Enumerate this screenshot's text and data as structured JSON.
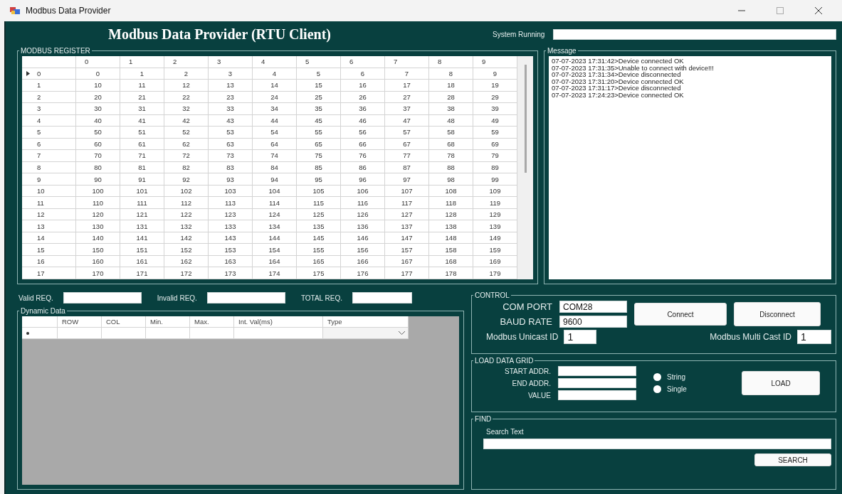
{
  "window": {
    "title": "Modbus Data Provider"
  },
  "header": {
    "title": "Modbus Data Provider (RTU Client)",
    "status_label": "System Running"
  },
  "register": {
    "title": "MODBUS REGISTER",
    "columns": [
      "0",
      "1",
      "2",
      "3",
      "4",
      "5",
      "6",
      "7",
      "8",
      "9"
    ],
    "rows": [
      {
        "header": "0",
        "selected": true,
        "cells": [
          "0",
          "1",
          "2",
          "3",
          "4",
          "5",
          "6",
          "7",
          "8",
          "9"
        ]
      },
      {
        "header": "1",
        "selected": false,
        "cells": [
          "10",
          "11",
          "12",
          "13",
          "14",
          "15",
          "16",
          "17",
          "18",
          "19"
        ]
      },
      {
        "header": "2",
        "selected": false,
        "cells": [
          "20",
          "21",
          "22",
          "23",
          "24",
          "25",
          "26",
          "27",
          "28",
          "29"
        ]
      },
      {
        "header": "3",
        "selected": false,
        "cells": [
          "30",
          "31",
          "32",
          "33",
          "34",
          "35",
          "36",
          "37",
          "38",
          "39"
        ]
      },
      {
        "header": "4",
        "selected": false,
        "cells": [
          "40",
          "41",
          "42",
          "43",
          "44",
          "45",
          "46",
          "47",
          "48",
          "49"
        ]
      },
      {
        "header": "5",
        "selected": false,
        "cells": [
          "50",
          "51",
          "52",
          "53",
          "54",
          "55",
          "56",
          "57",
          "58",
          "59"
        ]
      },
      {
        "header": "6",
        "selected": false,
        "cells": [
          "60",
          "61",
          "62",
          "63",
          "64",
          "65",
          "66",
          "67",
          "68",
          "69"
        ]
      },
      {
        "header": "7",
        "selected": false,
        "cells": [
          "70",
          "71",
          "72",
          "73",
          "74",
          "75",
          "76",
          "77",
          "78",
          "79"
        ]
      },
      {
        "header": "8",
        "selected": false,
        "cells": [
          "80",
          "81",
          "82",
          "83",
          "84",
          "85",
          "86",
          "87",
          "88",
          "89"
        ]
      },
      {
        "header": "9",
        "selected": false,
        "cells": [
          "90",
          "91",
          "92",
          "93",
          "94",
          "95",
          "96",
          "97",
          "98",
          "99"
        ]
      },
      {
        "header": "10",
        "selected": false,
        "cells": [
          "100",
          "101",
          "102",
          "103",
          "104",
          "105",
          "106",
          "107",
          "108",
          "109"
        ]
      },
      {
        "header": "11",
        "selected": false,
        "cells": [
          "110",
          "111",
          "112",
          "113",
          "114",
          "115",
          "116",
          "117",
          "118",
          "119"
        ]
      },
      {
        "header": "12",
        "selected": false,
        "cells": [
          "120",
          "121",
          "122",
          "123",
          "124",
          "125",
          "126",
          "127",
          "128",
          "129"
        ]
      },
      {
        "header": "13",
        "selected": false,
        "cells": [
          "130",
          "131",
          "132",
          "133",
          "134",
          "135",
          "136",
          "137",
          "138",
          "139"
        ]
      },
      {
        "header": "14",
        "selected": false,
        "cells": [
          "140",
          "141",
          "142",
          "143",
          "144",
          "145",
          "146",
          "147",
          "148",
          "149"
        ]
      },
      {
        "header": "15",
        "selected": false,
        "cells": [
          "150",
          "151",
          "152",
          "153",
          "154",
          "155",
          "156",
          "157",
          "158",
          "159"
        ]
      },
      {
        "header": "16",
        "selected": false,
        "cells": [
          "160",
          "161",
          "162",
          "163",
          "164",
          "165",
          "166",
          "167",
          "168",
          "169"
        ]
      },
      {
        "header": "17",
        "selected": false,
        "cells": [
          "170",
          "171",
          "172",
          "173",
          "174",
          "175",
          "176",
          "177",
          "178",
          "179"
        ]
      }
    ]
  },
  "message": {
    "title": "Message",
    "lines": [
      "07-07-2023 17:31:42>Device connected OK",
      "07-07-2023 17:31:35>Unable to connect with device!!!",
      "07-07-2023 17:31:34>Device disconnected",
      "07-07-2023 17:31:20>Device connected OK",
      "07-07-2023 17:31:17>Device disconnected",
      "07-07-2023 17:24:23>Device connected OK"
    ]
  },
  "counters": [
    {
      "label": "Valid REQ."
    },
    {
      "label": "Invalid REQ."
    },
    {
      "label": "TOTAL REQ."
    }
  ],
  "dynamic_data": {
    "title": "Dynamic Data",
    "columns": [
      "ROW",
      "COL",
      "Min.",
      "Max.",
      "Int. Val(ms)",
      "Type"
    ]
  },
  "control": {
    "title": "CONTROL",
    "com_port": {
      "label": "COM PORT",
      "value": "COM28"
    },
    "baud_rate": {
      "label": "BAUD RATE",
      "value": "9600"
    },
    "unicast": {
      "label": "Modbus Unicast ID",
      "value": "1"
    },
    "multicast": {
      "label": "Modbus Multi Cast ID",
      "value": "1"
    },
    "buttons": [
      "Connect",
      "Disconnect"
    ]
  },
  "load": {
    "title": "LOAD DATA GRID",
    "fields": [
      "START ADDR.",
      "END ADDR.",
      "VALUE"
    ],
    "options": [
      {
        "label": "String",
        "checked": false
      },
      {
        "label": "Single",
        "checked": false
      }
    ],
    "button": "LOAD"
  },
  "find": {
    "title": "FIND",
    "label": "Search Text",
    "button": "SEARCH"
  }
}
